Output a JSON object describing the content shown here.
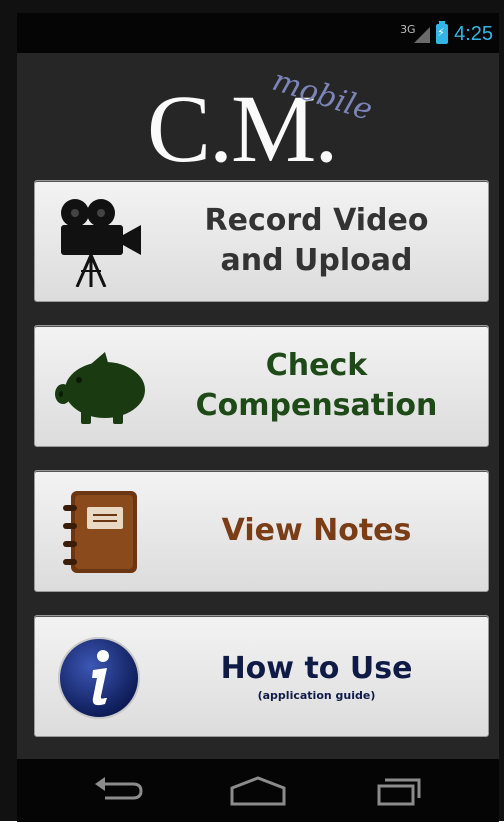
{
  "status_bar": {
    "network_label": "3G",
    "time": "4:25",
    "accent_color": "#33b5e5"
  },
  "logo": {
    "main": "C.M.",
    "sub": "mobile"
  },
  "buttons": [
    {
      "lines": [
        "Record Video",
        "and Upload"
      ],
      "icon": "video-camera-icon",
      "color": "#333333"
    },
    {
      "lines": [
        "Check",
        "Compensation"
      ],
      "icon": "piggy-bank-icon",
      "color": "#1d4a16"
    },
    {
      "lines": [
        "View Notes"
      ],
      "icon": "notebook-icon",
      "color": "#7a3d16"
    },
    {
      "lines": [
        "How to Use"
      ],
      "sub": "(application guide)",
      "icon": "info-icon",
      "color": "#0f1b46"
    }
  ],
  "nav_bar": {
    "icons": [
      "back-icon",
      "home-icon",
      "recent-apps-icon"
    ]
  }
}
